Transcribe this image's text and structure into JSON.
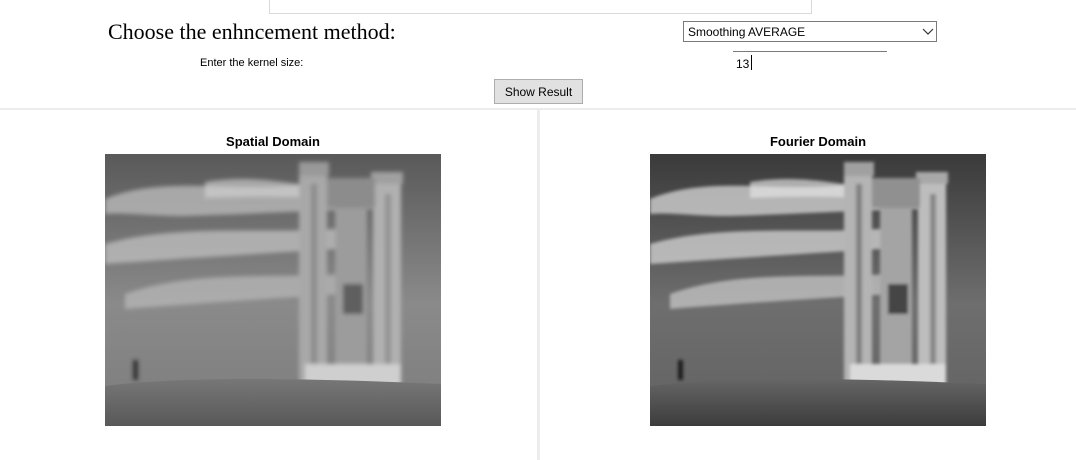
{
  "controls": {
    "method_label": "Choose the enhncement method:",
    "method_selected": "Smoothing AVERAGE",
    "kernel_label": "Enter the kernel size:",
    "kernel_value": "13",
    "show_button_label": "Show Result"
  },
  "panels": {
    "spatial_title": "Spatial Domain",
    "fourier_title": "Fourier Domain"
  },
  "icons": {
    "dropdown": "chevron-down-icon"
  }
}
